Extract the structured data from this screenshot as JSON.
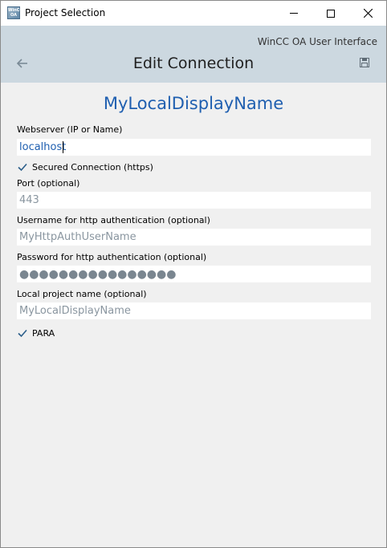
{
  "window": {
    "title": "Project Selection",
    "app_icon_text_top": "WinCC",
    "app_icon_text_bottom": "OA"
  },
  "header": {
    "brand": "WinCC OA User Interface",
    "title": "Edit Connection",
    "back_icon": "arrow-left-icon",
    "save_icon": "floppy-disk-icon"
  },
  "main": {
    "display_name": "MyLocalDisplayName",
    "webserver": {
      "label": "Webserver (IP or Name)",
      "value": "localhost"
    },
    "secured": {
      "label": "Secured Connection (https)",
      "checked": true
    },
    "port": {
      "label": "Port (optional)",
      "placeholder": "443",
      "value": ""
    },
    "username": {
      "label": "Username for http authentication (optional)",
      "placeholder": "MyHttpAuthUserName",
      "value": ""
    },
    "password": {
      "label": "Password for http authentication (optional)",
      "value": "●●●●●●●●●●●●●●●●"
    },
    "local_project": {
      "label": "Local project name (optional)",
      "placeholder": "MyLocalDisplayName",
      "value": ""
    },
    "para": {
      "label": "PARA",
      "checked": true
    }
  },
  "colors": {
    "header_bg": "#ccd8e0",
    "accent": "#1f5fb0",
    "placeholder": "#8a96a0",
    "window_bg": "#f0f0f0"
  }
}
